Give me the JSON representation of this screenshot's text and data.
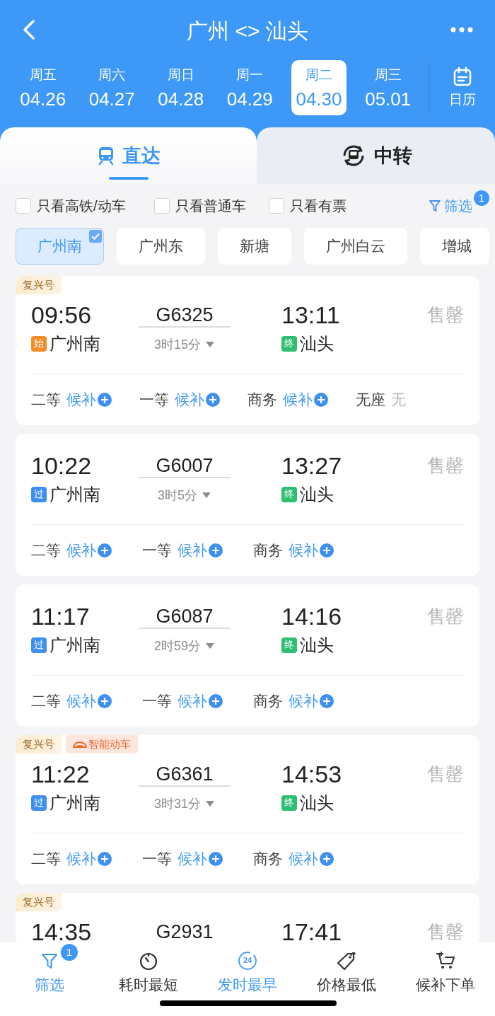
{
  "header": {
    "title": "广州 <> 汕头"
  },
  "dates": [
    {
      "weekday": "周五",
      "date": "04.26",
      "selected": false
    },
    {
      "weekday": "周六",
      "date": "04.27",
      "selected": false
    },
    {
      "weekday": "周日",
      "date": "04.28",
      "selected": false
    },
    {
      "weekday": "周一",
      "date": "04.29",
      "selected": false
    },
    {
      "weekday": "周二",
      "date": "04.30",
      "selected": true
    },
    {
      "weekday": "周三",
      "date": "05.01",
      "selected": false
    }
  ],
  "calendar": {
    "label": "日历"
  },
  "tabs": [
    {
      "label": "直达",
      "kind": "direct",
      "selected": true
    },
    {
      "label": "中转",
      "kind": "transfer",
      "selected": false
    }
  ],
  "filters": [
    {
      "label": "只看高铁/动车",
      "checked": false
    },
    {
      "label": "只看普通车",
      "checked": false
    },
    {
      "label": "只看有票",
      "checked": false
    }
  ],
  "filter_button": {
    "label": "筛选",
    "badge": "1"
  },
  "stations": [
    {
      "name": "广州南",
      "selected": true
    },
    {
      "name": "广州东",
      "selected": false
    },
    {
      "name": "新塘",
      "selected": false
    },
    {
      "name": "广州白云",
      "selected": false
    },
    {
      "name": "增城",
      "selected": false
    }
  ],
  "trains": [
    {
      "tags": [
        {
          "kind": "fuxing",
          "label": "复兴号"
        }
      ],
      "depart": "09:56",
      "train_no": "G6325",
      "arrive": "13:11",
      "duration": "3时15分",
      "from": {
        "badge": "始",
        "kind": "start",
        "name": "广州南"
      },
      "to": {
        "badge": "终",
        "kind": "end",
        "name": "汕头"
      },
      "status": "售罄",
      "seats": [
        {
          "class": "二等",
          "status": "候补",
          "kind": "waitlist"
        },
        {
          "class": "一等",
          "status": "候补",
          "kind": "waitlist"
        },
        {
          "class": "商务",
          "status": "候补",
          "kind": "waitlist"
        },
        {
          "class": "无座",
          "status": "无",
          "kind": "none"
        }
      ]
    },
    {
      "depart": "10:22",
      "train_no": "G6007",
      "arrive": "13:27",
      "duration": "3时5分",
      "from": {
        "badge": "过",
        "kind": "pass",
        "name": "广州南"
      },
      "to": {
        "badge": "终",
        "kind": "end",
        "name": "汕头"
      },
      "status": "售罄",
      "seats": [
        {
          "class": "二等",
          "status": "候补",
          "kind": "waitlist"
        },
        {
          "class": "一等",
          "status": "候补",
          "kind": "waitlist"
        },
        {
          "class": "商务",
          "status": "候补",
          "kind": "waitlist"
        }
      ]
    },
    {
      "depart": "11:17",
      "train_no": "G6087",
      "arrive": "14:16",
      "duration": "2时59分",
      "from": {
        "badge": "过",
        "kind": "pass",
        "name": "广州南"
      },
      "to": {
        "badge": "终",
        "kind": "end",
        "name": "汕头"
      },
      "status": "售罄",
      "seats": [
        {
          "class": "二等",
          "status": "候补",
          "kind": "waitlist"
        },
        {
          "class": "一等",
          "status": "候补",
          "kind": "waitlist"
        },
        {
          "class": "商务",
          "status": "候补",
          "kind": "waitlist"
        }
      ]
    },
    {
      "tags": [
        {
          "kind": "fuxing",
          "label": "复兴号"
        },
        {
          "kind": "smart",
          "label": "智能动车"
        }
      ],
      "depart": "11:22",
      "train_no": "G6361",
      "arrive": "14:53",
      "duration": "3时31分",
      "from": {
        "badge": "过",
        "kind": "pass",
        "name": "广州南"
      },
      "to": {
        "badge": "终",
        "kind": "end",
        "name": "汕头"
      },
      "status": "售罄",
      "seats": [
        {
          "class": "二等",
          "status": "候补",
          "kind": "waitlist"
        },
        {
          "class": "一等",
          "status": "候补",
          "kind": "waitlist"
        },
        {
          "class": "商务",
          "status": "候补",
          "kind": "waitlist"
        }
      ]
    },
    {
      "tags": [
        {
          "kind": "fuxing",
          "label": "复兴号"
        }
      ],
      "depart": "14:35",
      "train_no": "G2931",
      "arrive": "17:41",
      "status": "售罄"
    }
  ],
  "sort_bar": [
    {
      "kind": "filter",
      "label": "筛选",
      "badge": "1",
      "selected": true
    },
    {
      "kind": "duration",
      "label": "耗时最短",
      "selected": false
    },
    {
      "kind": "depart",
      "label": "发时最早",
      "icon_text": "24",
      "selected": true
    },
    {
      "kind": "price",
      "label": "价格最低",
      "selected": false
    },
    {
      "kind": "waitlist",
      "label": "候补下单",
      "selected": false
    }
  ]
}
